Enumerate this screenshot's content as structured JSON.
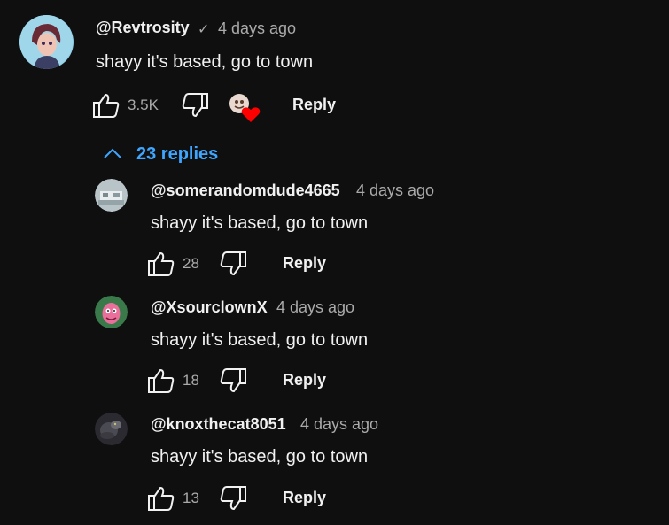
{
  "comment": {
    "author": "@Revtrosity",
    "time": "4 days ago",
    "text": "shayy it's based, go to town",
    "likes": "3.5K",
    "reply_label": "Reply"
  },
  "replies_toggle": {
    "label": "23 replies"
  },
  "replies": [
    {
      "author": "@somerandomdude4665",
      "time": "4 days ago",
      "text": "shayy it's based, go to town",
      "likes": "28",
      "reply_label": "Reply"
    },
    {
      "author": "@XsourclownX",
      "time": "4 days ago",
      "text": "shayy it's based, go to town",
      "likes": "18",
      "reply_label": "Reply"
    },
    {
      "author": "@knoxthecat8051",
      "time": "4 days ago",
      "text": "shayy it's based, go to town",
      "likes": "13",
      "reply_label": "Reply"
    }
  ],
  "colors": {
    "background": "#0f0f0f",
    "link": "#3ea6ff",
    "heart": "#ff0000"
  }
}
